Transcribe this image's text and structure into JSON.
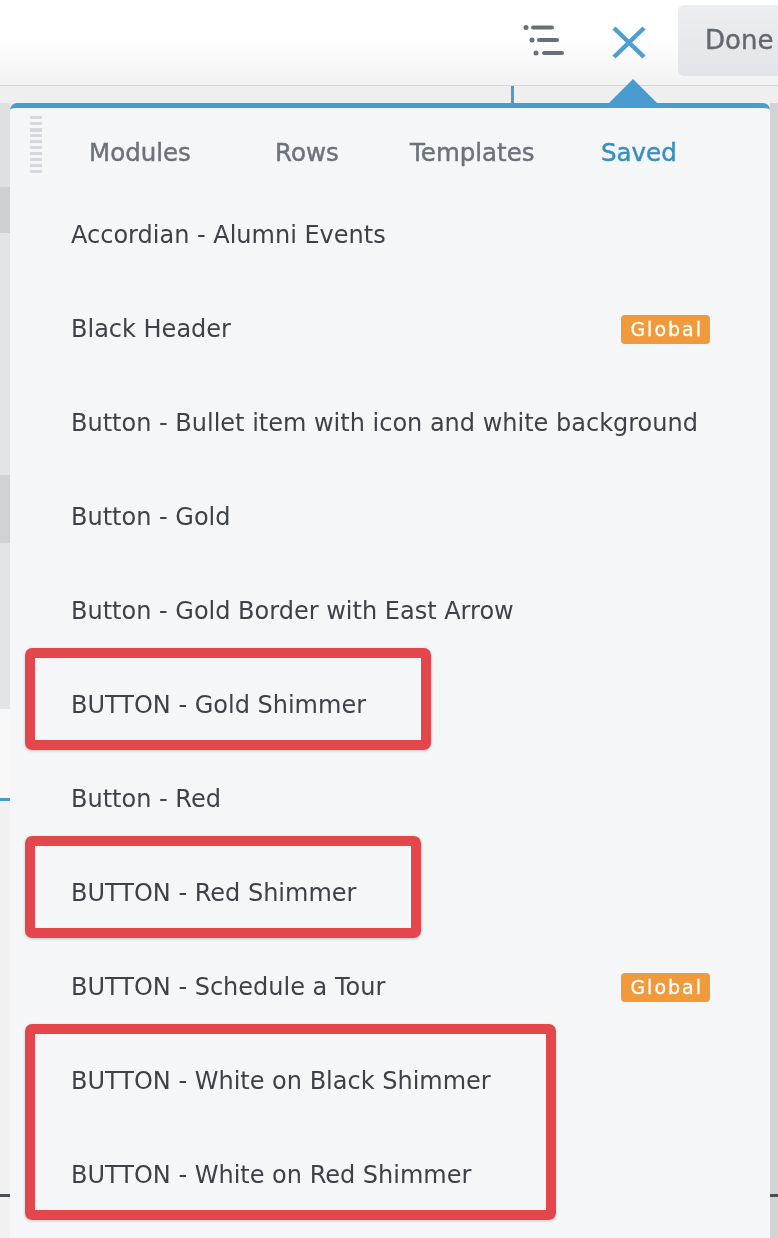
{
  "toolbar": {
    "done_button": "Done"
  },
  "panel": {
    "tabs": [
      {
        "label": "Modules",
        "selected": false
      },
      {
        "label": "Rows",
        "selected": false
      },
      {
        "label": "Templates",
        "selected": false
      },
      {
        "label": "Saved",
        "selected": true
      }
    ],
    "items": [
      {
        "label": "Accordian - Alumni Events",
        "highlighted": false
      },
      {
        "label": "Black Header",
        "badge": "Global",
        "highlighted": false
      },
      {
        "label": "Button - Bullet item with icon and white background",
        "highlighted": false
      },
      {
        "label": "Button - Gold",
        "highlighted": false
      },
      {
        "label": "Button - Gold Border with East Arrow",
        "highlighted": false
      },
      {
        "label": "BUTTON - Gold Shimmer",
        "highlighted": true
      },
      {
        "label": "Button - Red",
        "highlighted": false
      },
      {
        "label": "BUTTON - Red Shimmer",
        "highlighted": true
      },
      {
        "label": "BUTTON - Schedule a Tour",
        "badge": "Global",
        "highlighted": false
      },
      {
        "label": "BUTTON - White on Black Shimmer",
        "highlighted": true
      },
      {
        "label": "BUTTON - White on Red Shimmer",
        "highlighted": true
      }
    ]
  }
}
